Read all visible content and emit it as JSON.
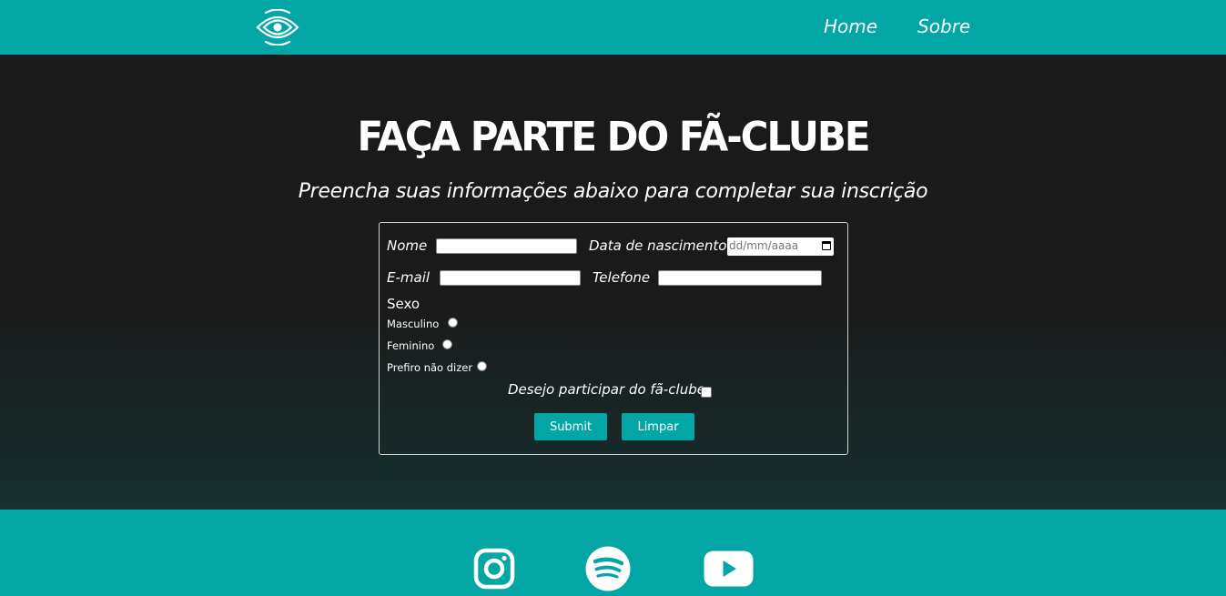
{
  "header": {
    "logo": "eye-logo",
    "nav": [
      {
        "label": "Home"
      },
      {
        "label": "Sobre"
      }
    ]
  },
  "main": {
    "title": "Faça parte do fã-clube",
    "subtitle": "Preencha suas informações abaixo para completar sua inscrição"
  },
  "form": {
    "name_label": "Nome",
    "birth_label": "Data de nascimento",
    "birth_placeholder": "dd/mm/aaaa",
    "email_label": "E-mail",
    "phone_label": "Telefone",
    "sex_label": "Sexo",
    "sex_options": [
      "Masculino",
      "Feminino",
      "Prefiro não dizer"
    ],
    "checkbox_label": "Desejo participar do fã-clube",
    "submit_label": "Submit",
    "reset_label": "Limpar"
  },
  "footer": {
    "icons": [
      "instagram-icon",
      "spotify-icon",
      "youtube-icon"
    ]
  },
  "colors": {
    "accent": "#02a6a5",
    "background": "#1a1a1a"
  }
}
